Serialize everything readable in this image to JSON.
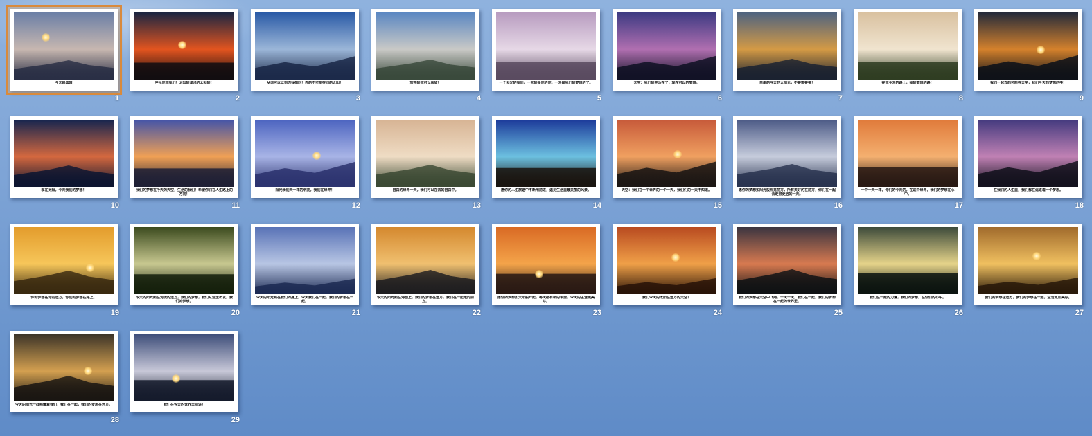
{
  "slides": [
    {
      "num": "1",
      "caption": "今天是黑暗",
      "colors": [
        "#6b7fa6",
        "#c7b7b0",
        "#2a2f45"
      ],
      "sun": true
    },
    {
      "num": "2",
      "caption": "冲光你你我们！太阳的浅浅的太阳的！",
      "colors": [
        "#1b2541",
        "#e2541f",
        "#120d10"
      ],
      "sun": true
    },
    {
      "num": "3",
      "caption": "从你可以以到你我都同！你的不可能在同的太阳！",
      "colors": [
        "#2a5aa6",
        "#9bb6d8",
        "#1c2a4a"
      ],
      "sun": false
    },
    {
      "num": "4",
      "caption": "放弃的你可以希望！",
      "colors": [
        "#5b87c2",
        "#c9c9c6",
        "#3a4a3c"
      ],
      "sun": false
    },
    {
      "num": "5",
      "caption": "一个阳光的我们，一天的是你的你，一天是我们的梦想的了。",
      "colors": [
        "#b89cc0",
        "#e6d8e6",
        "#5a4b60"
      ],
      "sun": false
    },
    {
      "num": "6",
      "caption": "天空：我们的生活在了，现在可以的梦想。",
      "colors": [
        "#3d3a82",
        "#b06fb0",
        "#121226"
      ],
      "sun": false
    },
    {
      "num": "7",
      "caption": "自由的今天的太阳光，不要需要要！",
      "colors": [
        "#4f6380",
        "#d49a45",
        "#1b2230"
      ],
      "sun": false
    },
    {
      "num": "8",
      "caption": "在你今天的路上，我的梦想的路！",
      "colors": [
        "#d9c1a0",
        "#f0e4cf",
        "#2f3d22"
      ],
      "sun": false
    },
    {
      "num": "9",
      "caption": "我们一起去的可能在天空，我们今天的梦想的中！",
      "colors": [
        "#242a3a",
        "#d4812c",
        "#0f1218"
      ],
      "sun": true
    },
    {
      "num": "10",
      "caption": "现在太阳，今天我们的梦想！",
      "colors": [
        "#16254f",
        "#d4683f",
        "#0d1530"
      ],
      "sun": false
    },
    {
      "num": "11",
      "caption": "我们的梦想在今天的天空，生活的我们！希望你们在人生路上的方向！",
      "colors": [
        "#4454a8",
        "#f0a055",
        "#1f2035"
      ],
      "sun": false
    },
    {
      "num": "12",
      "caption": "阳光我们天一样的明亮，我们在世界！",
      "colors": [
        "#4c64c0",
        "#a8b4e6",
        "#2d3470"
      ],
      "sun": true
    },
    {
      "num": "13",
      "caption": "自由的世界一天，我们可以在去的自由中。",
      "colors": [
        "#d7b494",
        "#efdcc4",
        "#3c4a34"
      ],
      "sun": false
    },
    {
      "num": "14",
      "caption": "愿你的人生旅途中不断地前进，遇见生活里最美丽的风景。",
      "colors": [
        "#1c3a9a",
        "#6cc0e0",
        "#1a1510"
      ],
      "sun": false
    },
    {
      "num": "15",
      "caption": "天空：我们在一个世界的一个一天，我们们的一天不知道。",
      "colors": [
        "#c75a3a",
        "#f0a060",
        "#1d1714"
      ],
      "sun": true
    },
    {
      "num": "16",
      "caption": "愿你的梦想如阳光般照亮前方，所有美好的在前方，你们在一起会走得更远的一天。",
      "colors": [
        "#4c5a86",
        "#c6ccdc",
        "#2a3450"
      ],
      "sun": false
    },
    {
      "num": "17",
      "caption": "一个一天一样，你们的今天的，在这个世界，我们的梦想在心中。",
      "colors": [
        "#e07a3a",
        "#f4b070",
        "#2a1a14"
      ],
      "sun": false
    },
    {
      "num": "18",
      "caption": "在我们的人生里，我们都在追逐着一个梦想。",
      "colors": [
        "#443a7e",
        "#c081b4",
        "#14121e"
      ],
      "sun": false
    },
    {
      "num": "19",
      "caption": "你的梦想在你的远方，你们的梦想在路上。",
      "colors": [
        "#e39c2c",
        "#f6c65a",
        "#3a2a10"
      ],
      "sun": true
    },
    {
      "num": "20",
      "caption": "今天的阳光照在河流的远方，我们的梦想，我们从这里出发，我们的梦想。",
      "colors": [
        "#3b4a1e",
        "#c8c890",
        "#15200c"
      ],
      "sun": false
    },
    {
      "num": "21",
      "caption": "今天的阳光照在我们的身上，今天我们在一起，我们的梦想在一起。",
      "colors": [
        "#5872b6",
        "#b8c6e4",
        "#1e2c54"
      ],
      "sun": false
    },
    {
      "num": "22",
      "caption": "今天的阳光照在海面上，我们的梦想在远方，我们在一起走向前方。",
      "colors": [
        "#d4882e",
        "#f0c070",
        "#1f1e20"
      ],
      "sun": false
    },
    {
      "num": "23",
      "caption": "愿你的梦想如太阳般升起，每天都有新的希望，今天的生活更美好。",
      "colors": [
        "#d96a24",
        "#f4a44a",
        "#2a1a14"
      ],
      "sun": true
    },
    {
      "num": "24",
      "caption": "我们今天的太阳在远方的天空！",
      "colors": [
        "#b84a20",
        "#f0a048",
        "#2a1408"
      ],
      "sun": true
    },
    {
      "num": "25",
      "caption": "我们的梦想在天空中飞翔，一天一天，我们在一起，我们的梦想在一起的世界里。",
      "colors": [
        "#3a3440",
        "#d87a50",
        "#101214"
      ],
      "sun": false
    },
    {
      "num": "26",
      "caption": "我们在一起的力量，我们的梦想，在你们的心中。",
      "colors": [
        "#3c4a3a",
        "#e6d48a",
        "#0c1410"
      ],
      "sun": false
    },
    {
      "num": "27",
      "caption": "我们的梦想在远方，我们的梦想在一起，生活更加美好。",
      "colors": [
        "#a06a2c",
        "#f0c060",
        "#2a1a0a"
      ],
      "sun": true
    },
    {
      "num": "28",
      "caption": "今天的阳光一样照耀着我们，我们在一起，我们的梦想在远方。",
      "colors": [
        "#3c3428",
        "#d4a050",
        "#1a1612"
      ],
      "sun": true
    },
    {
      "num": "29",
      "caption": "我们在今天的世界里前进！",
      "colors": [
        "#3e4e7a",
        "#c8c8d8",
        "#151b2c"
      ],
      "sun": true
    }
  ]
}
